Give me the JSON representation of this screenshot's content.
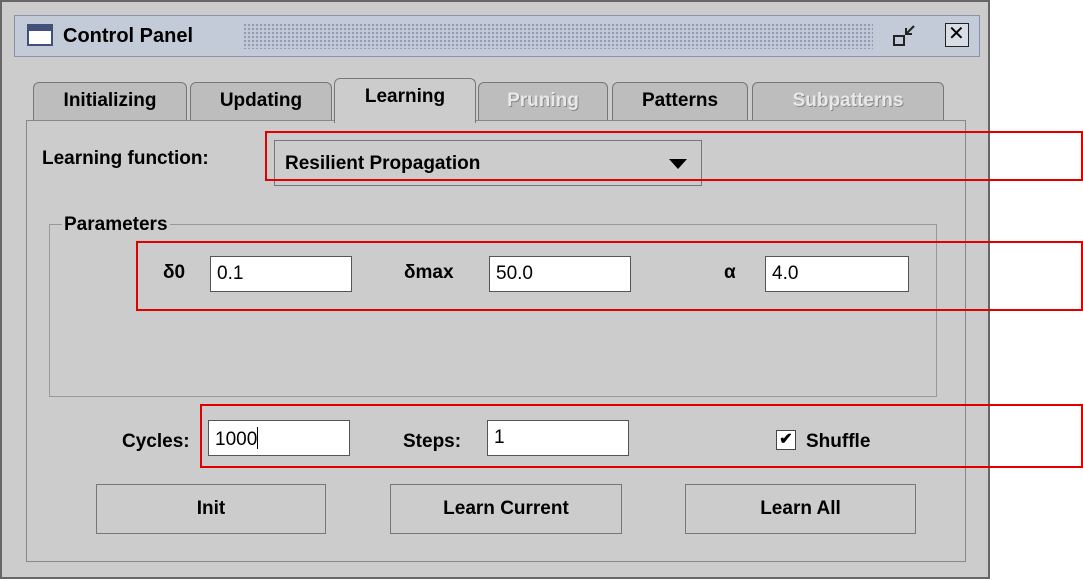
{
  "window": {
    "title": "Control Panel"
  },
  "tabs": [
    {
      "label": "Initializing",
      "state": "normal"
    },
    {
      "label": "Updating",
      "state": "normal"
    },
    {
      "label": "Learning",
      "state": "active"
    },
    {
      "label": "Pruning",
      "state": "disabled"
    },
    {
      "label": "Patterns",
      "state": "normal"
    },
    {
      "label": "Subpatterns",
      "state": "disabled"
    }
  ],
  "learning": {
    "function_label": "Learning function:",
    "function_value": "Resilient Propagation"
  },
  "parameters": {
    "title": "Parameters",
    "p1_label": "δ0",
    "p1_value": "0.1",
    "p2_label": "δmax",
    "p2_value": "50.0",
    "p3_label": "α",
    "p3_value": "4.0"
  },
  "run": {
    "cycles_label": "Cycles:",
    "cycles_value": "1000",
    "steps_label": "Steps:",
    "steps_value": "1",
    "shuffle_label": "Shuffle",
    "shuffle_checked": true,
    "check_mark": "✔"
  },
  "buttons": {
    "init": "Init",
    "learn_current": "Learn Current",
    "learn_all": "Learn All"
  },
  "annotation_color": "#e00000"
}
